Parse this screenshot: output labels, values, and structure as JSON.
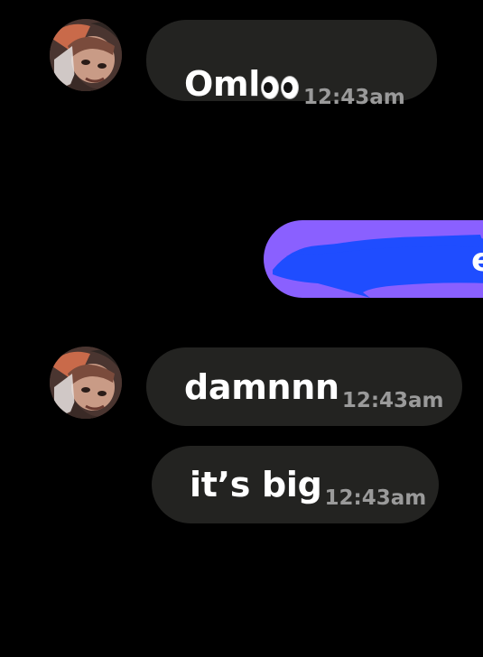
{
  "messages": [
    {
      "text": "Oml",
      "emoji": "eyes-emoji",
      "time": "12:43am"
    },
    {
      "text": "damnnn",
      "time": "12:43am"
    },
    {
      "text": "it’s big",
      "time": "12:43am"
    }
  ],
  "sent_message": {
    "visible_fragment": "e"
  },
  "colors": {
    "background": "#000000",
    "incoming_bubble": "#232321",
    "outgoing_bubble": "#8a60ff",
    "redaction": "#1f4dff",
    "timestamp": "#9a9a9a"
  }
}
